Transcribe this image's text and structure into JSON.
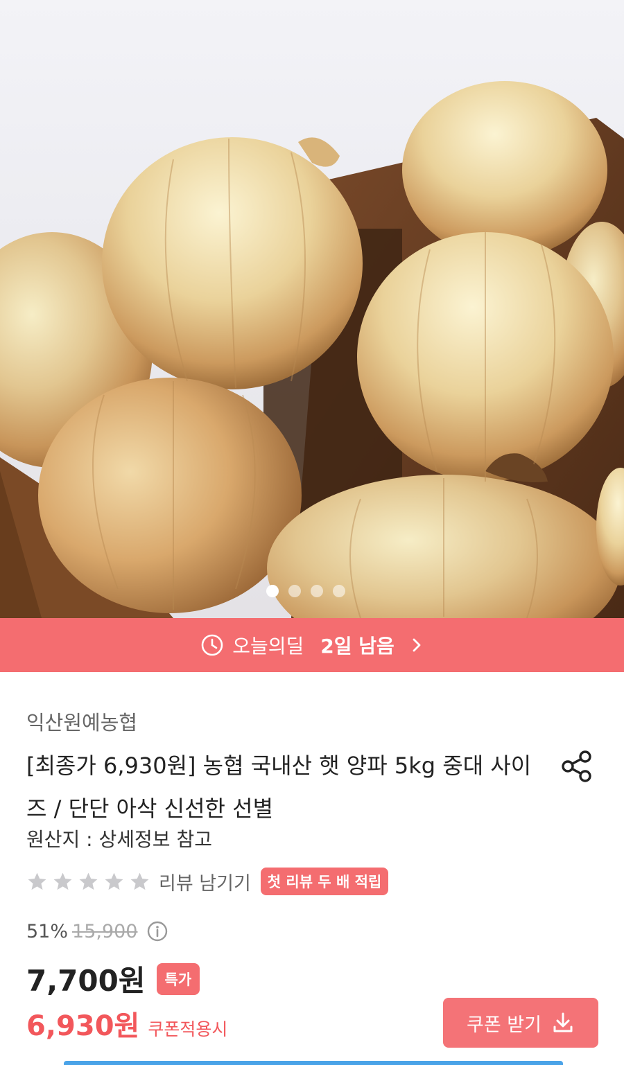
{
  "product_image": {
    "description_icon": "onion-photo",
    "carousel_dots": 4,
    "active_dot": 1
  },
  "deal": {
    "label": "오늘의딜",
    "remaining": "2일 남음",
    "icon": "clock-icon",
    "color": "#f46d70"
  },
  "product": {
    "seller": "익산원예농협",
    "title": "[최종가 6,930원] 농협 국내산 햇 양파 5kg 중대 사이즈 / 단단 아삭 신선한 선별",
    "origin": "원산지 : 상세정보 참고",
    "rating_stars": 5,
    "rating_value": 0,
    "review_link": "리뷰 남기기",
    "review_badge": "첫 리뷰 두 배 적립",
    "discount_rate": "51%",
    "original_price": "15,900",
    "price": "7,700원",
    "special_badge": "특가",
    "coupon_price": "6,930원",
    "coupon_note": "쿠폰적용시",
    "coupon_button": "쿠폰 받기"
  },
  "colors": {
    "accent": "#f46d70",
    "coupon_red": "#f2575b"
  }
}
